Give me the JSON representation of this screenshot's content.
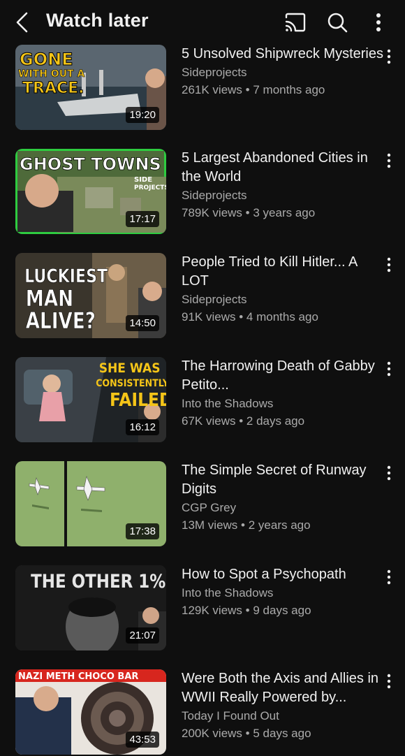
{
  "header": {
    "title": "Watch later",
    "back_icon": "chevron-left-icon",
    "cast_icon": "cast-icon",
    "search_icon": "search-icon",
    "more_icon": "more-vertical-icon"
  },
  "videos": [
    {
      "title": "5 Unsolved Shipwreck Mysteries",
      "channel": "Sideprojects",
      "views": "261K views",
      "age": "7 months ago",
      "duration": "19:20",
      "thumb_text": [
        "GONE",
        "WITH OUT A",
        "TRACE."
      ]
    },
    {
      "title": "5 Largest Abandoned Cities in the World",
      "channel": "Sideprojects",
      "views": "789K views",
      "age": "3 years ago",
      "duration": "17:17",
      "thumb_text": [
        "GHOST TOWNS",
        "SIDE",
        "PROJECTS"
      ]
    },
    {
      "title": "People Tried to Kill Hitler... A LOT",
      "channel": "Sideprojects",
      "views": "91K views",
      "age": "4 months ago",
      "duration": "14:50",
      "thumb_text": [
        "LUCKIEST",
        "MAN",
        "ALIVE?"
      ]
    },
    {
      "title": "The Harrowing Death of Gabby Petito...",
      "channel": "Into the Shadows",
      "views": "67K views",
      "age": "2 days ago",
      "duration": "16:12",
      "thumb_text": [
        "SHE WAS",
        "CONSISTENTLY",
        "FAILED"
      ]
    },
    {
      "title": "The Simple Secret of Runway Digits",
      "channel": "CGP Grey",
      "views": "13M views",
      "age": "2 years ago",
      "duration": "17:38",
      "thumb_text": []
    },
    {
      "title": "How to Spot a Psychopath",
      "channel": "Into the Shadows",
      "views": "129K views",
      "age": "9 days ago",
      "duration": "21:07",
      "thumb_text": [
        "THE OTHER 1%"
      ]
    },
    {
      "title": "Were Both the Axis and Allies in WWII Really Powered by...",
      "channel": "Today I Found Out",
      "views": "200K views",
      "age": "5 days ago",
      "duration": "43:53",
      "thumb_text": [
        "NAZI METH CHOCO BAR"
      ]
    }
  ],
  "separator": "•",
  "colors": {
    "background": "#0f0f0f",
    "text_primary": "#f1f1f1",
    "text_secondary": "#aaaaaa",
    "thumb_yellow": "#f5c518",
    "thumb_green_border": "#2ecc40",
    "thumb_red_banner": "#d7261e"
  }
}
